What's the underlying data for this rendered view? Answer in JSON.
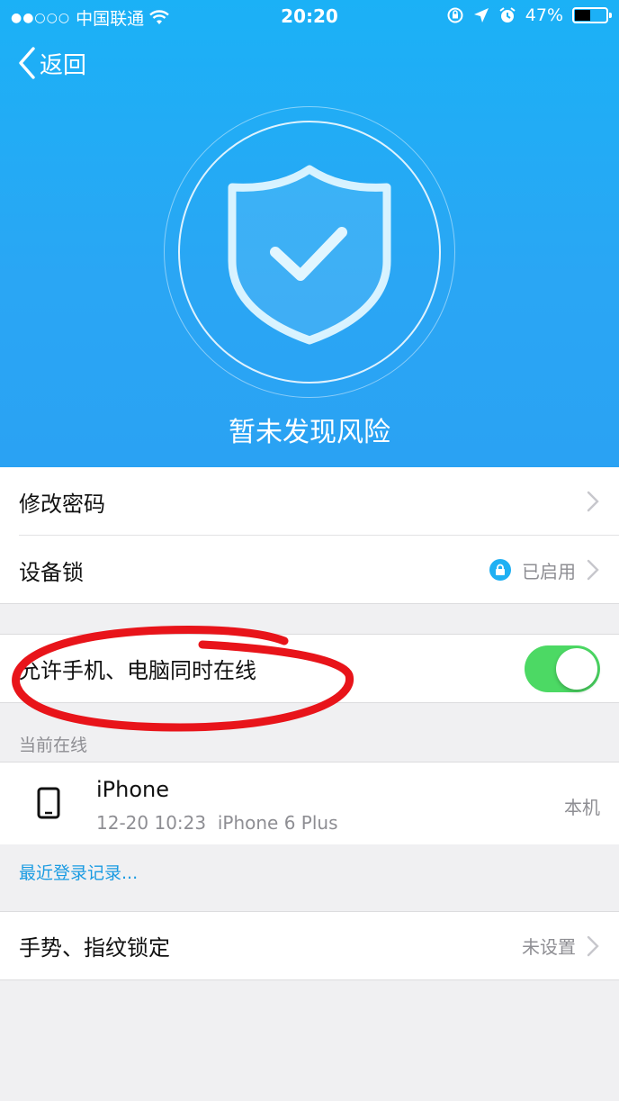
{
  "status_bar": {
    "signal": "●●○○○",
    "carrier": "中国联通",
    "time": "20:20",
    "battery": "47%"
  },
  "nav": {
    "back_label": "返回"
  },
  "hero": {
    "status_text": "暂未发现风险"
  },
  "settings": {
    "change_password": "修改密码",
    "device_lock": {
      "label": "设备锁",
      "value": "已启用"
    },
    "allow_both_online": {
      "label": "允许手机、电脑同时在线",
      "enabled": true
    }
  },
  "online": {
    "section_label": "当前在线",
    "device": {
      "name": "iPhone",
      "time": "12-20 10:23",
      "model": "iPhone 6 Plus",
      "tag": "本机"
    },
    "recent_login_link": "最近登录记录..."
  },
  "gesture_lock": {
    "label": "手势、指纹锁定",
    "value": "未设置"
  },
  "colors": {
    "hero": "#1bb1f6",
    "toggle_on": "#4cd964",
    "link": "#1a9be2",
    "annotation": "#e8141a"
  },
  "icons": [
    "wifi-icon",
    "rotation-lock-icon",
    "location-icon",
    "alarm-icon",
    "battery-icon",
    "back-chevron-icon",
    "shield-check-icon",
    "chevron-right-icon",
    "lock-icon",
    "phone-icon"
  ]
}
